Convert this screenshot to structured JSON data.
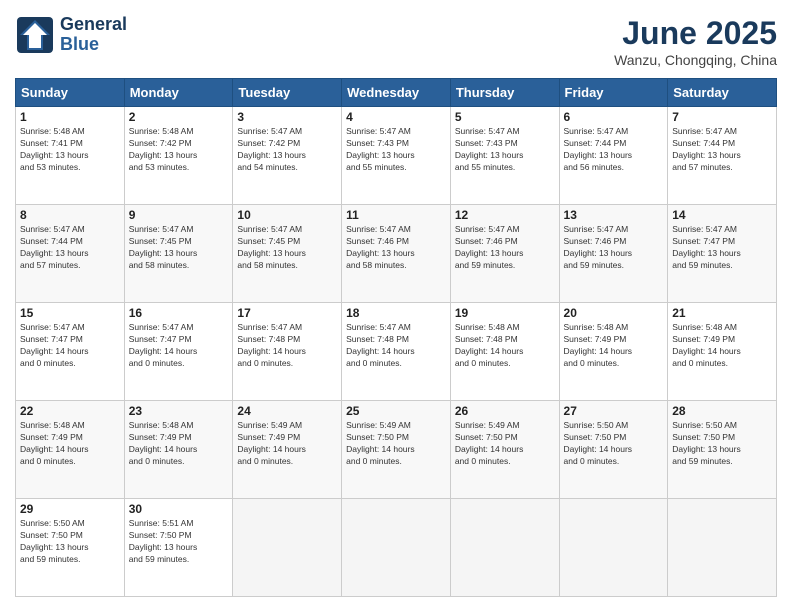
{
  "header": {
    "logo_line1": "General",
    "logo_line2": "Blue",
    "title": "June 2025",
    "subtitle": "Wanzu, Chongqing, China"
  },
  "days_of_week": [
    "Sunday",
    "Monday",
    "Tuesday",
    "Wednesday",
    "Thursday",
    "Friday",
    "Saturday"
  ],
  "weeks": [
    [
      {
        "day": "1",
        "sunrise": "5:48 AM",
        "sunset": "7:41 PM",
        "daylight": "13 hours and 53 minutes."
      },
      {
        "day": "2",
        "sunrise": "5:48 AM",
        "sunset": "7:42 PM",
        "daylight": "13 hours and 53 minutes."
      },
      {
        "day": "3",
        "sunrise": "5:47 AM",
        "sunset": "7:42 PM",
        "daylight": "13 hours and 54 minutes."
      },
      {
        "day": "4",
        "sunrise": "5:47 AM",
        "sunset": "7:43 PM",
        "daylight": "13 hours and 55 minutes."
      },
      {
        "day": "5",
        "sunrise": "5:47 AM",
        "sunset": "7:43 PM",
        "daylight": "13 hours and 55 minutes."
      },
      {
        "day": "6",
        "sunrise": "5:47 AM",
        "sunset": "7:44 PM",
        "daylight": "13 hours and 56 minutes."
      },
      {
        "day": "7",
        "sunrise": "5:47 AM",
        "sunset": "7:44 PM",
        "daylight": "13 hours and 57 minutes."
      }
    ],
    [
      {
        "day": "8",
        "sunrise": "5:47 AM",
        "sunset": "7:44 PM",
        "daylight": "13 hours and 57 minutes."
      },
      {
        "day": "9",
        "sunrise": "5:47 AM",
        "sunset": "7:45 PM",
        "daylight": "13 hours and 58 minutes."
      },
      {
        "day": "10",
        "sunrise": "5:47 AM",
        "sunset": "7:45 PM",
        "daylight": "13 hours and 58 minutes."
      },
      {
        "day": "11",
        "sunrise": "5:47 AM",
        "sunset": "7:46 PM",
        "daylight": "13 hours and 58 minutes."
      },
      {
        "day": "12",
        "sunrise": "5:47 AM",
        "sunset": "7:46 PM",
        "daylight": "13 hours and 59 minutes."
      },
      {
        "day": "13",
        "sunrise": "5:47 AM",
        "sunset": "7:46 PM",
        "daylight": "13 hours and 59 minutes."
      },
      {
        "day": "14",
        "sunrise": "5:47 AM",
        "sunset": "7:47 PM",
        "daylight": "13 hours and 59 minutes."
      }
    ],
    [
      {
        "day": "15",
        "sunrise": "5:47 AM",
        "sunset": "7:47 PM",
        "daylight": "14 hours and 0 minutes."
      },
      {
        "day": "16",
        "sunrise": "5:47 AM",
        "sunset": "7:47 PM",
        "daylight": "14 hours and 0 minutes."
      },
      {
        "day": "17",
        "sunrise": "5:47 AM",
        "sunset": "7:48 PM",
        "daylight": "14 hours and 0 minutes."
      },
      {
        "day": "18",
        "sunrise": "5:47 AM",
        "sunset": "7:48 PM",
        "daylight": "14 hours and 0 minutes."
      },
      {
        "day": "19",
        "sunrise": "5:48 AM",
        "sunset": "7:48 PM",
        "daylight": "14 hours and 0 minutes."
      },
      {
        "day": "20",
        "sunrise": "5:48 AM",
        "sunset": "7:49 PM",
        "daylight": "14 hours and 0 minutes."
      },
      {
        "day": "21",
        "sunrise": "5:48 AM",
        "sunset": "7:49 PM",
        "daylight": "14 hours and 0 minutes."
      }
    ],
    [
      {
        "day": "22",
        "sunrise": "5:48 AM",
        "sunset": "7:49 PM",
        "daylight": "14 hours and 0 minutes."
      },
      {
        "day": "23",
        "sunrise": "5:48 AM",
        "sunset": "7:49 PM",
        "daylight": "14 hours and 0 minutes."
      },
      {
        "day": "24",
        "sunrise": "5:49 AM",
        "sunset": "7:49 PM",
        "daylight": "14 hours and 0 minutes."
      },
      {
        "day": "25",
        "sunrise": "5:49 AM",
        "sunset": "7:50 PM",
        "daylight": "14 hours and 0 minutes."
      },
      {
        "day": "26",
        "sunrise": "5:49 AM",
        "sunset": "7:50 PM",
        "daylight": "14 hours and 0 minutes."
      },
      {
        "day": "27",
        "sunrise": "5:50 AM",
        "sunset": "7:50 PM",
        "daylight": "14 hours and 0 minutes."
      },
      {
        "day": "28",
        "sunrise": "5:50 AM",
        "sunset": "7:50 PM",
        "daylight": "13 hours and 59 minutes."
      }
    ],
    [
      {
        "day": "29",
        "sunrise": "5:50 AM",
        "sunset": "7:50 PM",
        "daylight": "13 hours and 59 minutes."
      },
      {
        "day": "30",
        "sunrise": "5:51 AM",
        "sunset": "7:50 PM",
        "daylight": "13 hours and 59 minutes."
      },
      null,
      null,
      null,
      null,
      null
    ]
  ]
}
